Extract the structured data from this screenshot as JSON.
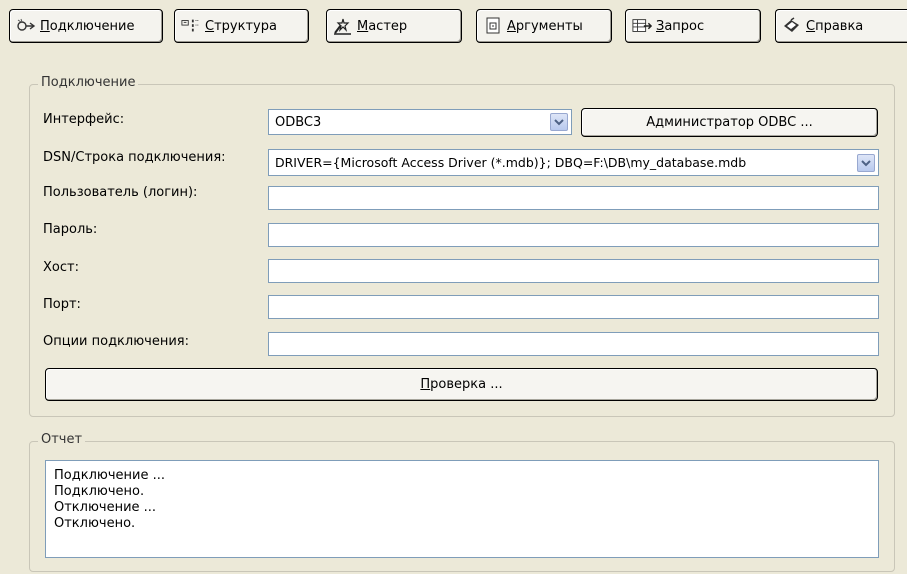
{
  "toolbar": {
    "connection": {
      "pre": "",
      "u": "П",
      "post": "одключение",
      "icon": "connect-icon"
    },
    "structure": {
      "pre": "",
      "u": "С",
      "post": "труктура",
      "icon": "structure-icon"
    },
    "wizard": {
      "pre": "",
      "u": "М",
      "post": "астер",
      "icon": "wizard-icon"
    },
    "arguments": {
      "pre": "",
      "u": "А",
      "post": "ргументы",
      "icon": "arguments-icon"
    },
    "query": {
      "pre": "",
      "u": "З",
      "post": "апрос",
      "icon": "query-icon"
    },
    "help": {
      "pre": "",
      "u": "С",
      "post": "правка",
      "icon": "help-icon"
    }
  },
  "connection_group": {
    "title": "Подключение",
    "interface_label": "Интерфейс:",
    "interface_value": "ODBC3",
    "odbc_admin_button": "Администратор ODBC ...",
    "dsn_label": "DSN/Строка подключения:",
    "dsn_value": "DRIVER={Microsoft Access Driver (*.mdb)}; DBQ=F:\\DB\\my_database.mdb",
    "user_label": "Пользователь (логин):",
    "user_value": "",
    "password_label": "Пароль:",
    "password_value": "",
    "host_label": "Хост:",
    "host_value": "",
    "port_label": "Порт:",
    "port_value": "",
    "options_label": "Опции подключения:",
    "options_value": "",
    "test_button": {
      "u": "П",
      "post": "роверка ..."
    }
  },
  "report_group": {
    "title": "Отчет",
    "lines": [
      "Подключение ...",
      "Подключено.",
      "Отключение ...",
      "Отключено."
    ]
  },
  "colors": {
    "window_bg": "#ece9d8",
    "field_border": "#7f9db9",
    "group_border": "#c9c6b8"
  }
}
